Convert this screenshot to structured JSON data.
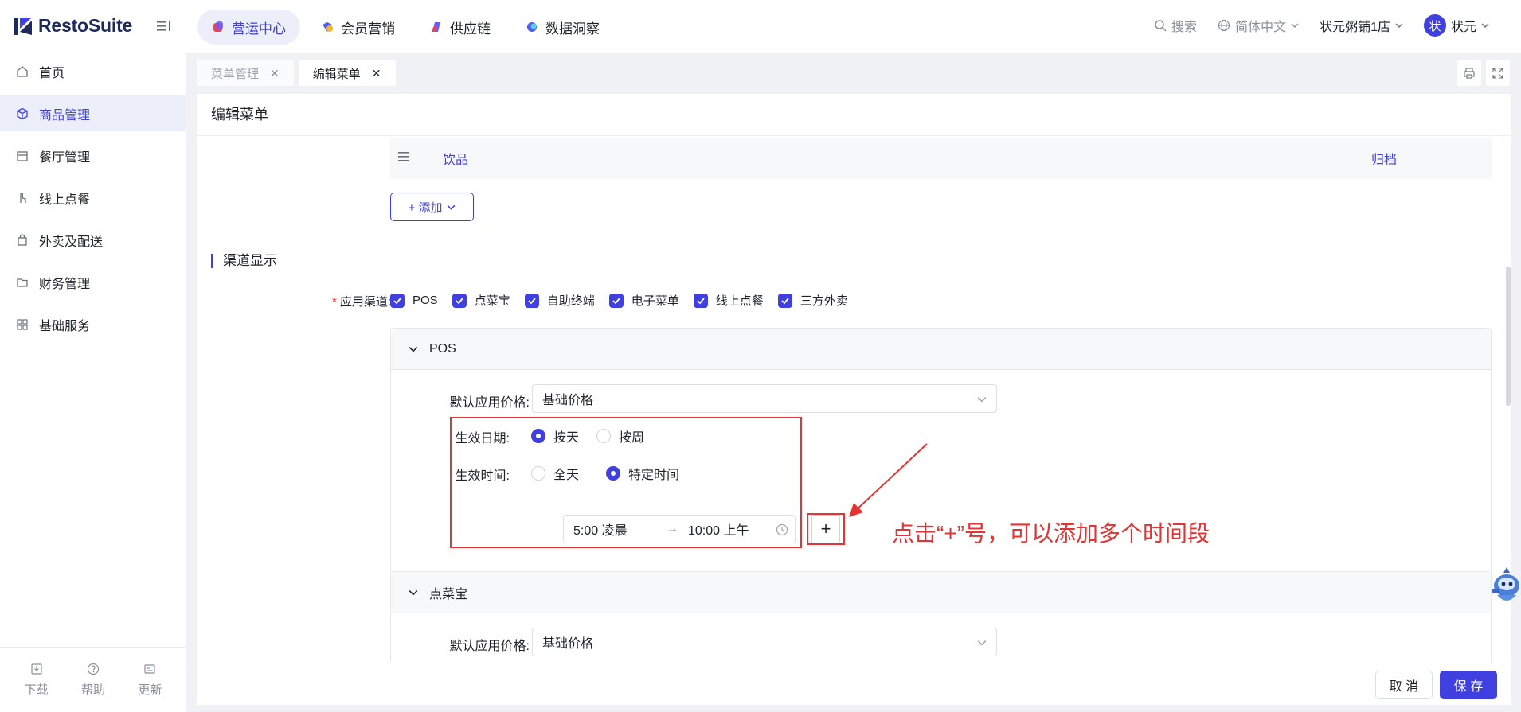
{
  "app": {
    "brand": "RestoSuite"
  },
  "topnav": [
    {
      "label": "营运中心",
      "icon": "operations-icon",
      "active": true
    },
    {
      "label": "会员营销",
      "icon": "membership-icon",
      "active": false
    },
    {
      "label": "供应链",
      "icon": "supply-chain-icon",
      "active": false
    },
    {
      "label": "数据洞察",
      "icon": "data-insight-icon",
      "active": false
    }
  ],
  "topright": {
    "search": "搜索",
    "language": "简体中文",
    "store": "状元粥铺1店",
    "avatar_char": "状",
    "user": "状元"
  },
  "sidebar": {
    "items": [
      {
        "label": "首页",
        "icon": "home-icon"
      },
      {
        "label": "商品管理",
        "icon": "cube-icon"
      },
      {
        "label": "餐厅管理",
        "icon": "store-icon"
      },
      {
        "label": "线上点餐",
        "icon": "hand-pointer-icon"
      },
      {
        "label": "外卖及配送",
        "icon": "bag-icon"
      },
      {
        "label": "财务管理",
        "icon": "folder-icon"
      },
      {
        "label": "基础服务",
        "icon": "grid-icon"
      }
    ],
    "active_index": 1,
    "footer": [
      {
        "label": "下载",
        "icon": "download-icon"
      },
      {
        "label": "帮助",
        "icon": "help-icon"
      },
      {
        "label": "更新",
        "icon": "update-icon"
      }
    ]
  },
  "tabs": [
    {
      "label": "菜单管理",
      "active": false
    },
    {
      "label": "编辑菜单",
      "active": true
    }
  ],
  "page": {
    "title": "编辑菜单",
    "group_row": {
      "name": "饮品",
      "action": "归档"
    },
    "add_button": "+ 添加",
    "section_title": "渠道显示",
    "channels_label": "应用渠道:",
    "channels": [
      "POS",
      "点菜宝",
      "自助终端",
      "电子菜单",
      "线上点餐",
      "三方外卖"
    ],
    "pos_panel": {
      "title": "POS",
      "price_label": "默认应用价格:",
      "price_value": "基础价格",
      "date_label": "生效日期:",
      "date_options": [
        "按天",
        "按周"
      ],
      "date_selected": "按天",
      "time_label": "生效时间:",
      "time_options": [
        "全天",
        "特定时间"
      ],
      "time_selected": "特定时间",
      "time_start": "5:00 凌晨",
      "time_sep": "→",
      "time_end": "10:00 上午",
      "plus": "+"
    },
    "second_panel": {
      "title": "点菜宝",
      "price_label": "默认应用价格:",
      "price_value": "基础价格"
    },
    "annotation": "点击“+”号，可以添加多个时间段"
  },
  "footer": {
    "cancel": "取 消",
    "save": "保 存"
  },
  "colors": {
    "accent": "#4040e0",
    "annotation": "#e53333"
  }
}
